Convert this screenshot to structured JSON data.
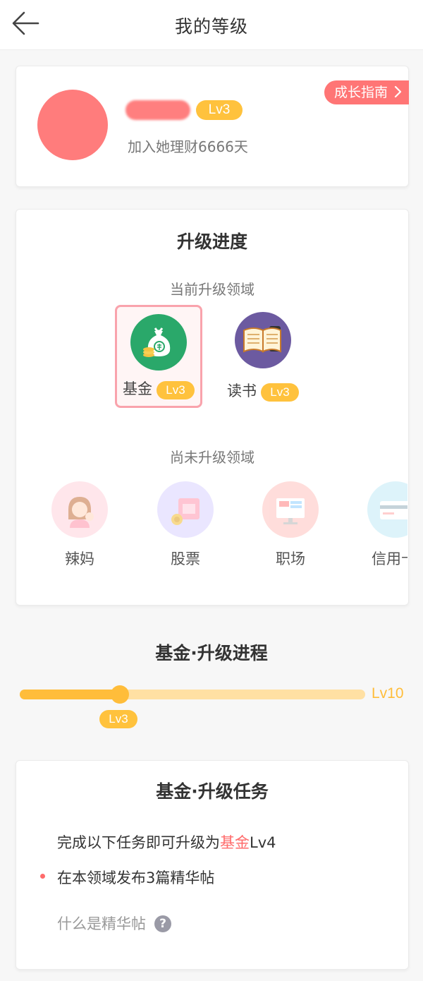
{
  "header": {
    "title": "我的等级",
    "back_icon": "arrow-left-icon"
  },
  "profile": {
    "level": "Lv3",
    "joined_text": "加入她理财6666天",
    "guide_label": "成长指南",
    "guide_icon": "chevron-right-icon",
    "avatar_color": "#ff7c7c"
  },
  "progress": {
    "title": "升级进度",
    "current_label": "当前升级领域",
    "current_domains": [
      {
        "name": "基金",
        "level": "Lv3",
        "icon": "money-bag-icon",
        "color": "#2aa86a",
        "selected": true
      },
      {
        "name": "读书",
        "level": "Lv3",
        "icon": "open-book-icon",
        "color": "#6c5aa0",
        "selected": false
      }
    ],
    "pending_label": "尚未升级领域",
    "pending_domains": [
      {
        "name": "辣妈",
        "icon": "mother-child-icon"
      },
      {
        "name": "股票",
        "icon": "stock-coins-icon"
      },
      {
        "name": "职场",
        "icon": "monitor-icon"
      },
      {
        "name": "信用卡",
        "icon": "credit-card-icon"
      }
    ]
  },
  "track": {
    "title": "基金·升级进程",
    "current_level": "Lv3",
    "max_level": "Lv10",
    "progress_fraction": 0.29
  },
  "tasks": {
    "title": "基金·升级任务",
    "intro_prefix": "完成以下任务即可升级为",
    "intro_domain": "基金",
    "intro_level": "Lv4",
    "items": [
      "在本领域发布3篇精华帖"
    ],
    "faq_label": "什么是精华帖",
    "faq_icon": "question-circle-icon"
  },
  "colors": {
    "accent": "#ffbd3a",
    "highlight": "#ff6b6b"
  }
}
